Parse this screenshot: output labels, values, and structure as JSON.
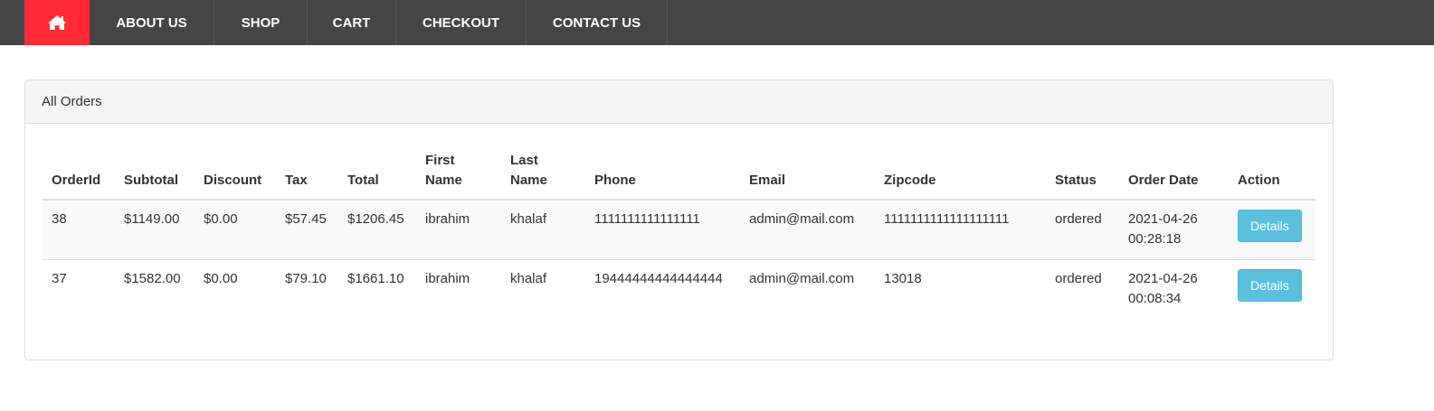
{
  "nav": {
    "home_icon": "home-icon",
    "items": [
      {
        "label": "ABOUT US"
      },
      {
        "label": "SHOP"
      },
      {
        "label": "CART"
      },
      {
        "label": "CHECKOUT"
      },
      {
        "label": "CONTACT US"
      }
    ]
  },
  "colors": {
    "navbar_bg": "#454545",
    "home_active": "#ff2a35",
    "details_button": "#5bc0de"
  },
  "panel": {
    "heading": "All Orders"
  },
  "table": {
    "headers": {
      "order_id": "OrderId",
      "subtotal": "Subtotal",
      "discount": "Discount",
      "tax": "Tax",
      "total": "Total",
      "first_name_1": "First",
      "first_name_2": "Name",
      "last_name_1": "Last",
      "last_name_2": "Name",
      "phone": "Phone",
      "email": "Email",
      "zipcode": "Zipcode",
      "status": "Status",
      "order_date": "Order Date",
      "action": "Action"
    },
    "rows": [
      {
        "order_id": "38",
        "subtotal": "$1149.00",
        "discount": "$0.00",
        "tax": "$57.45",
        "total": "$1206.45",
        "first_name": "ibrahim",
        "last_name": "khalaf",
        "phone": "1111111111111111",
        "email": "admin@mail.com",
        "zipcode": "1111111111111111111",
        "status": "ordered",
        "date": "2021-04-26",
        "time": "00:28:18",
        "action_label": "Details"
      },
      {
        "order_id": "37",
        "subtotal": "$1582.00",
        "discount": "$0.00",
        "tax": "$79.10",
        "total": "$1661.10",
        "first_name": "ibrahim",
        "last_name": "khalaf",
        "phone": "19444444444444444",
        "email": "admin@mail.com",
        "zipcode": "13018",
        "status": "ordered",
        "date": "2021-04-26",
        "time": "00:08:34",
        "action_label": "Details"
      }
    ]
  }
}
